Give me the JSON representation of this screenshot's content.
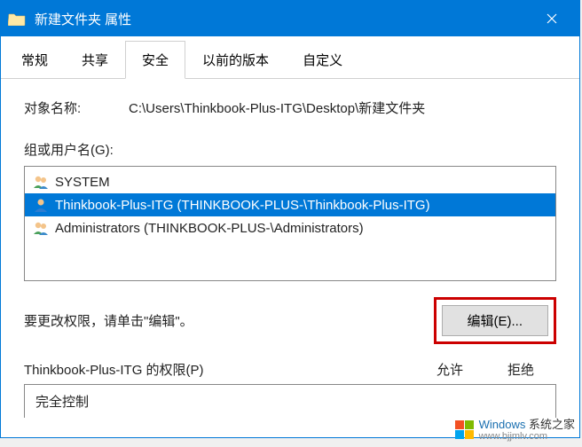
{
  "titlebar": {
    "title": "新建文件夹 属性"
  },
  "tabs": {
    "items": [
      {
        "label": "常规"
      },
      {
        "label": "共享"
      },
      {
        "label": "安全"
      },
      {
        "label": "以前的版本"
      },
      {
        "label": "自定义"
      }
    ],
    "activeIndex": 2
  },
  "object": {
    "label": "对象名称:",
    "value": "C:\\Users\\Thinkbook-Plus-ITG\\Desktop\\新建文件夹"
  },
  "groups": {
    "label": "组或用户名(G):",
    "items": [
      {
        "name": "SYSTEM",
        "type": "group",
        "selected": false
      },
      {
        "name": "Thinkbook-Plus-ITG (THINKBOOK-PLUS-\\Thinkbook-Plus-ITG)",
        "type": "user",
        "selected": true
      },
      {
        "name": "Administrators (THINKBOOK-PLUS-\\Administrators)",
        "type": "group",
        "selected": false
      }
    ]
  },
  "edit": {
    "text": "要更改权限，请单击\"编辑\"。",
    "button": "编辑(E)..."
  },
  "permissions": {
    "label": "Thinkbook-Plus-ITG 的权限(P)",
    "allow": "允许",
    "deny": "拒绝",
    "rows": [
      {
        "name": "完全控制"
      }
    ]
  },
  "watermark": {
    "brand": "Windows",
    "suffix": "系统之家",
    "url": "www.bjjmlv.com"
  }
}
